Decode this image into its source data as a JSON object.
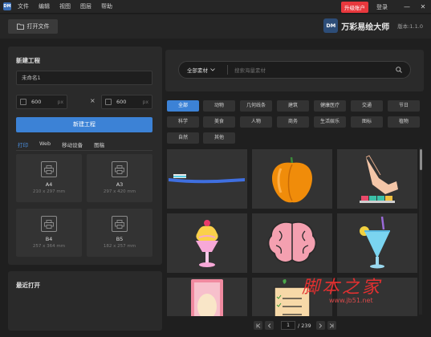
{
  "menu": [
    "文件",
    "编辑",
    "视图",
    "图层",
    "帮助"
  ],
  "titlebar": {
    "upgrade": "升级账户",
    "login": "登录",
    "minimize": "—",
    "close": "✕"
  },
  "toolbar": {
    "open_label": "打开文件"
  },
  "brand": {
    "logo": "DM",
    "name": "万彩易绘大师",
    "version": "版本:1.1.0"
  },
  "new_project": {
    "title": "新建工程",
    "name_value": "未命名1",
    "width": "600",
    "height": "600",
    "unit": "px",
    "times": "×",
    "create_label": "新建工程",
    "tabs": [
      "打印",
      "Web",
      "移动设备",
      "图稿"
    ],
    "active_tab": "打印",
    "cards": [
      {
        "name": "A4",
        "size": "210 x 297 mm"
      },
      {
        "name": "A3",
        "size": "297 x 420 mm"
      },
      {
        "name": "B4",
        "size": "257 x 364 mm"
      },
      {
        "name": "B5",
        "size": "182 x 257 mm"
      }
    ]
  },
  "recent": {
    "title": "最近打开"
  },
  "search": {
    "select_label": "全部素材",
    "placeholder": "搜索海量素材"
  },
  "categories": [
    "全部",
    "动物",
    "几何线条",
    "建筑",
    "健康医疗",
    "交通",
    "节日",
    "科学",
    "美食",
    "人物",
    "商务",
    "生活娱乐",
    "图标",
    "植物",
    "自然",
    "其他"
  ],
  "active_category": "全部",
  "gallery_items": [
    "toothbrush",
    "bell-pepper",
    "hand-pointing-keyboard",
    "ice-cream-sundae",
    "brain",
    "cocktail",
    "face-mask",
    "clipboard-plant",
    "misc"
  ],
  "pager": {
    "current": "1",
    "total": "/ 239"
  },
  "watermark": {
    "title": "脚本之家",
    "url": "www.jb51.net"
  },
  "colors": {
    "accent": "#3c82d6",
    "upgrade": "#e8383d",
    "panel": "#2a2a2a",
    "bg": "#1f1f1f"
  }
}
